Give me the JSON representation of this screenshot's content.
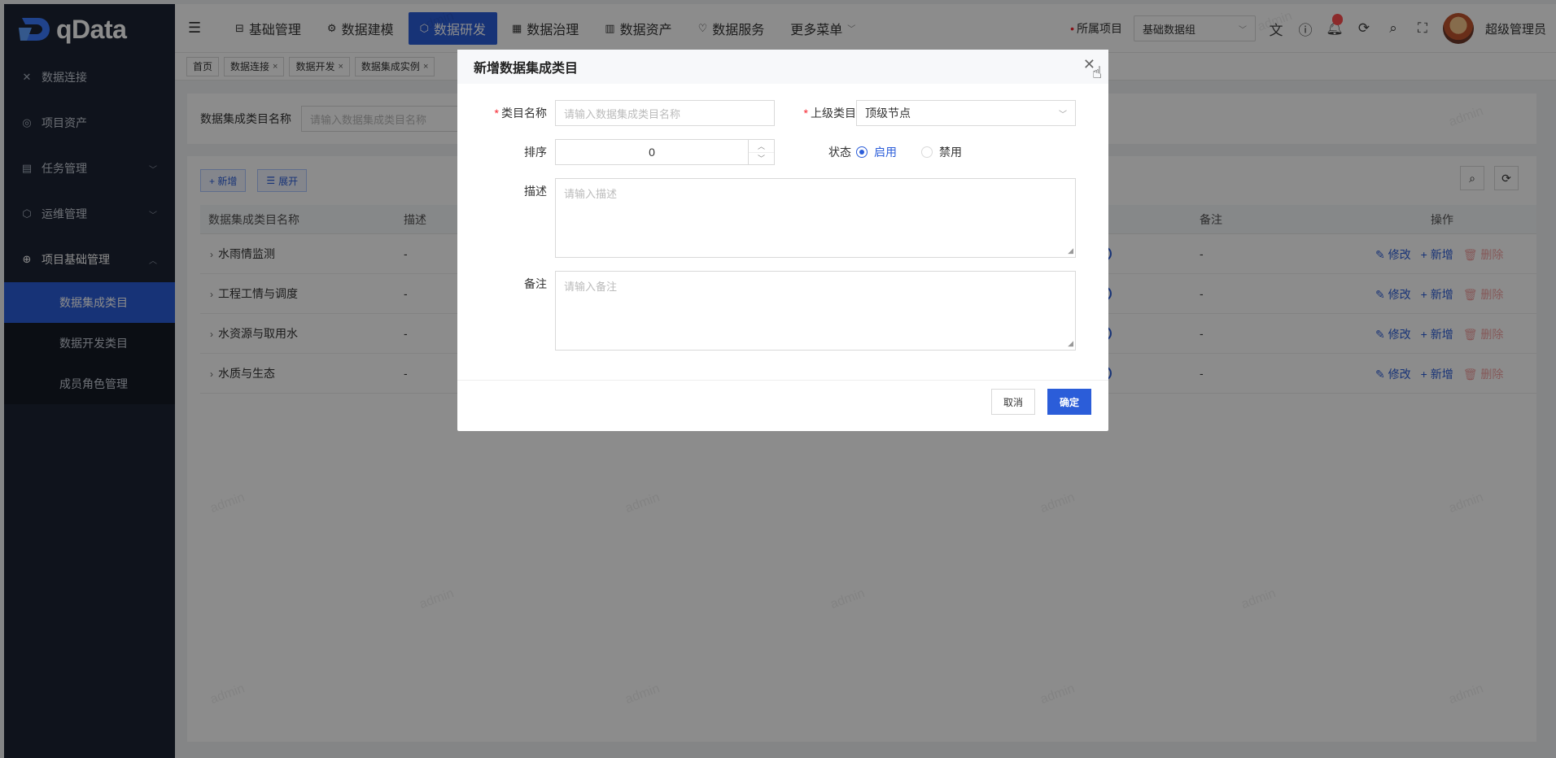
{
  "app": {
    "logo_text": "qData"
  },
  "sidebar": {
    "items": [
      {
        "label": "数据连接",
        "icon": "connect-icon"
      },
      {
        "label": "项目资产",
        "icon": "asset-icon"
      },
      {
        "label": "任务管理",
        "icon": "task-icon"
      },
      {
        "label": "运维管理",
        "icon": "ops-icon"
      },
      {
        "label": "项目基础管理",
        "icon": "globe-icon"
      }
    ],
    "subitems": [
      {
        "label": "数据集成类目",
        "active": true
      },
      {
        "label": "数据开发类目",
        "active": false
      },
      {
        "label": "成员角色管理",
        "active": false
      }
    ]
  },
  "topnav": {
    "items": [
      {
        "label": "基础管理"
      },
      {
        "label": "数据建模"
      },
      {
        "label": "数据研发",
        "active": true
      },
      {
        "label": "数据治理"
      },
      {
        "label": "数据资产"
      },
      {
        "label": "数据服务"
      },
      {
        "label": "更多菜单"
      }
    ],
    "project_label": "所属项目",
    "project_value": "基础数据组",
    "user_name": "超级管理员"
  },
  "tabs": [
    "首页",
    "数据连接",
    "数据开发",
    "数据集成实例"
  ],
  "search": {
    "label": "数据集成类目名称",
    "placeholder": "请输入数据集成类目名称"
  },
  "toolbar": {
    "add_label": "+ 新增",
    "expand_label": "展开"
  },
  "table": {
    "headers": {
      "name": "数据集成类目名称",
      "desc": "描述",
      "remark": "备注",
      "ops": "操作"
    },
    "rows": [
      {
        "name": "水雨情监测",
        "desc": "-",
        "remark": "-"
      },
      {
        "name": "工程工情与调度",
        "desc": "-",
        "remark": "-"
      },
      {
        "name": "水资源与取用水",
        "desc": "-",
        "remark": "-"
      },
      {
        "name": "水质与生态",
        "desc": "-",
        "remark": "-"
      }
    ],
    "op_edit": "修改",
    "op_add": "新增",
    "op_delete": "删除"
  },
  "watermark": "admin",
  "modal": {
    "title": "新增数据集成类目",
    "name_label": "类目名称",
    "name_placeholder": "请输入数据集成类目名称",
    "parent_label": "上级类目",
    "parent_value": "顶级节点",
    "order_label": "排序",
    "order_value": "0",
    "status_label": "状态",
    "status_enable": "启用",
    "status_disable": "禁用",
    "desc_label": "描述",
    "desc_placeholder": "请输入描述",
    "remark_label": "备注",
    "remark_placeholder": "请输入备注",
    "cancel": "取消",
    "ok": "确定"
  },
  "colors": {
    "primary": "#2b5dd9",
    "sidebar_bg": "#1d2433",
    "danger": "#f5222d"
  }
}
